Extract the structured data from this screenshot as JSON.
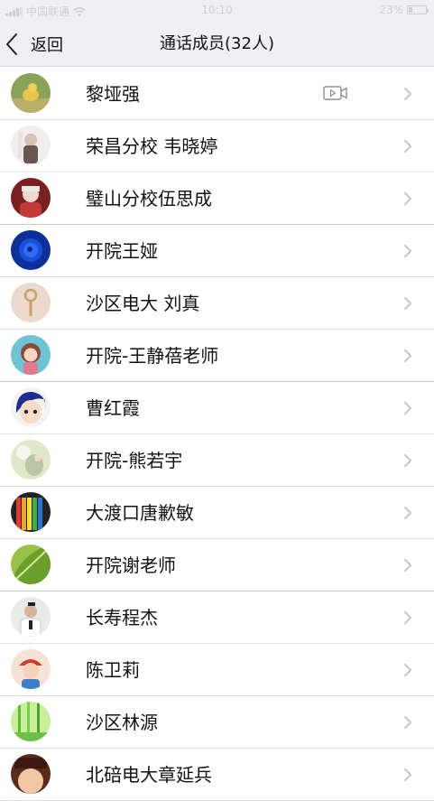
{
  "status_bar": {
    "carrier": "中国联通",
    "time": "10:10",
    "battery": "23%",
    "battery_level": 0.23,
    "wifi_icon": "wifi-icon"
  },
  "nav": {
    "back_label": "返回",
    "title": "通话成员(32人)"
  },
  "colors": {
    "bar_bg": "#efeff4",
    "separator": "#e4e4e6",
    "chevron": "#c7c7cc",
    "text": "#111111"
  },
  "members": [
    {
      "name": "黎垭强",
      "has_video": true,
      "avatar_theme": "duckling"
    },
    {
      "name": "荣昌分校 韦晓婷",
      "has_video": false,
      "avatar_theme": "girl-photo"
    },
    {
      "name": "璧山分校伍思成",
      "has_video": false,
      "avatar_theme": "child-red"
    },
    {
      "name": "开院王娅",
      "has_video": false,
      "avatar_theme": "blue-rose"
    },
    {
      "name": "沙区电大 刘真",
      "has_video": false,
      "avatar_theme": "key-pendant"
    },
    {
      "name": "开院-王静蓓老师",
      "has_video": false,
      "avatar_theme": "cartoon-girl"
    },
    {
      "name": "曹红霞",
      "has_video": false,
      "avatar_theme": "anime-face"
    },
    {
      "name": "开院-熊若宇",
      "has_video": false,
      "avatar_theme": "soft-photo"
    },
    {
      "name": "大渡口唐歉敏",
      "has_video": false,
      "avatar_theme": "color-pencils"
    },
    {
      "name": "开院谢老师",
      "has_video": false,
      "avatar_theme": "green-leaf"
    },
    {
      "name": "长寿程杰",
      "has_video": false,
      "avatar_theme": "man-portrait"
    },
    {
      "name": "陈卫莉",
      "has_video": false,
      "avatar_theme": "red-cap-child"
    },
    {
      "name": "沙区林源",
      "has_video": false,
      "avatar_theme": "bamboo-forest"
    },
    {
      "name": "北碚电大章延兵",
      "has_video": false,
      "avatar_theme": "cartoon-dark"
    }
  ]
}
